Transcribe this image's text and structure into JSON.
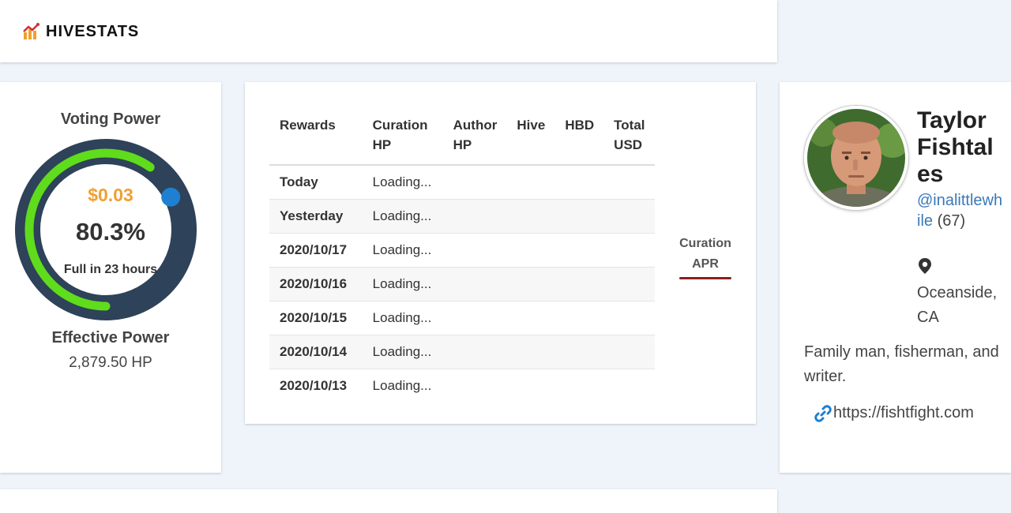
{
  "header": {
    "logo_text": "HIVESTATS",
    "logo_icon": "chart-increasing-icon"
  },
  "voting": {
    "title": "Voting Power",
    "value_usd": "$0.03",
    "percent_text": "80.3%",
    "percent": 80.3,
    "full_in": "Full in 23 hours",
    "effective_title": "Effective Power",
    "effective_value": "2,879.50 HP",
    "colors": {
      "ring_bg": "#2e4259",
      "ring_fill": "#5fdc1b",
      "knob": "#1f7fd1",
      "value": "#f0a030"
    }
  },
  "rewards": {
    "headers": [
      "Rewards",
      "Curation HP",
      "Author HP",
      "Hive",
      "HBD",
      "Total USD"
    ],
    "rows": [
      {
        "label": "Today",
        "value": "Loading..."
      },
      {
        "label": "Yesterday",
        "value": "Loading..."
      },
      {
        "label": "2020/10/17",
        "value": "Loading..."
      },
      {
        "label": "2020/10/16",
        "value": "Loading..."
      },
      {
        "label": "2020/10/15",
        "value": "Loading..."
      },
      {
        "label": "2020/10/14",
        "value": "Loading..."
      },
      {
        "label": "2020/10/13",
        "value": "Loading..."
      }
    ],
    "apr_tab": {
      "line1": "Curation",
      "line2": "APR",
      "underline_color": "#8b1e1e"
    }
  },
  "profile": {
    "name": "Taylor Fishtales",
    "handle": "@inalittlewhile",
    "reputation": "(67)",
    "location": "Oceanside, CA",
    "bio": "Family man, fisherman, and writer.",
    "website": "https://fishtfight.com",
    "handle_color": "#3a78b8"
  }
}
